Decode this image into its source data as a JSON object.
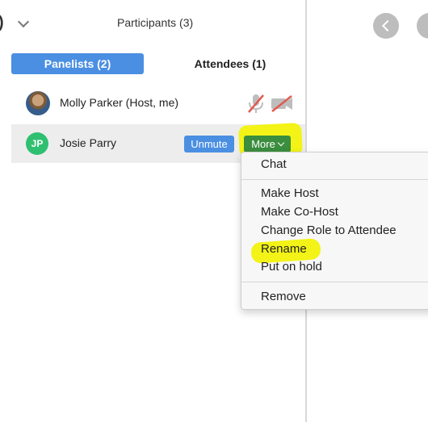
{
  "header": {
    "edge_glyph": ")",
    "title": "Participants (3)"
  },
  "tabs": [
    {
      "label": "Panelists (2)",
      "selected": true
    },
    {
      "label": "Attendees (1)",
      "selected": false
    }
  ],
  "participants": [
    {
      "name": "Molly Parker (Host, me)",
      "avatar": "photo",
      "mic": "muted",
      "video": "off"
    },
    {
      "name": "Josie Parry",
      "avatar_initials": "JP",
      "unmute_label": "Unmute",
      "more_label": "More"
    }
  ],
  "context_menu": {
    "items": [
      "Chat",
      "Make Host",
      "Make Co-Host",
      "Change Role to Attendee",
      "Rename",
      "Put on hold",
      "Remove"
    ],
    "highlighted_item": "Rename"
  },
  "colors": {
    "accent_blue": "#4a8fe2",
    "more_green": "#3b8e3e",
    "highlight_yellow": "#f3f317",
    "muted_red": "#e05a4e",
    "avatar_green": "#2fbf71"
  },
  "icons": [
    "chevron-down-icon",
    "mic-muted-icon",
    "video-off-icon",
    "back-icon"
  ]
}
